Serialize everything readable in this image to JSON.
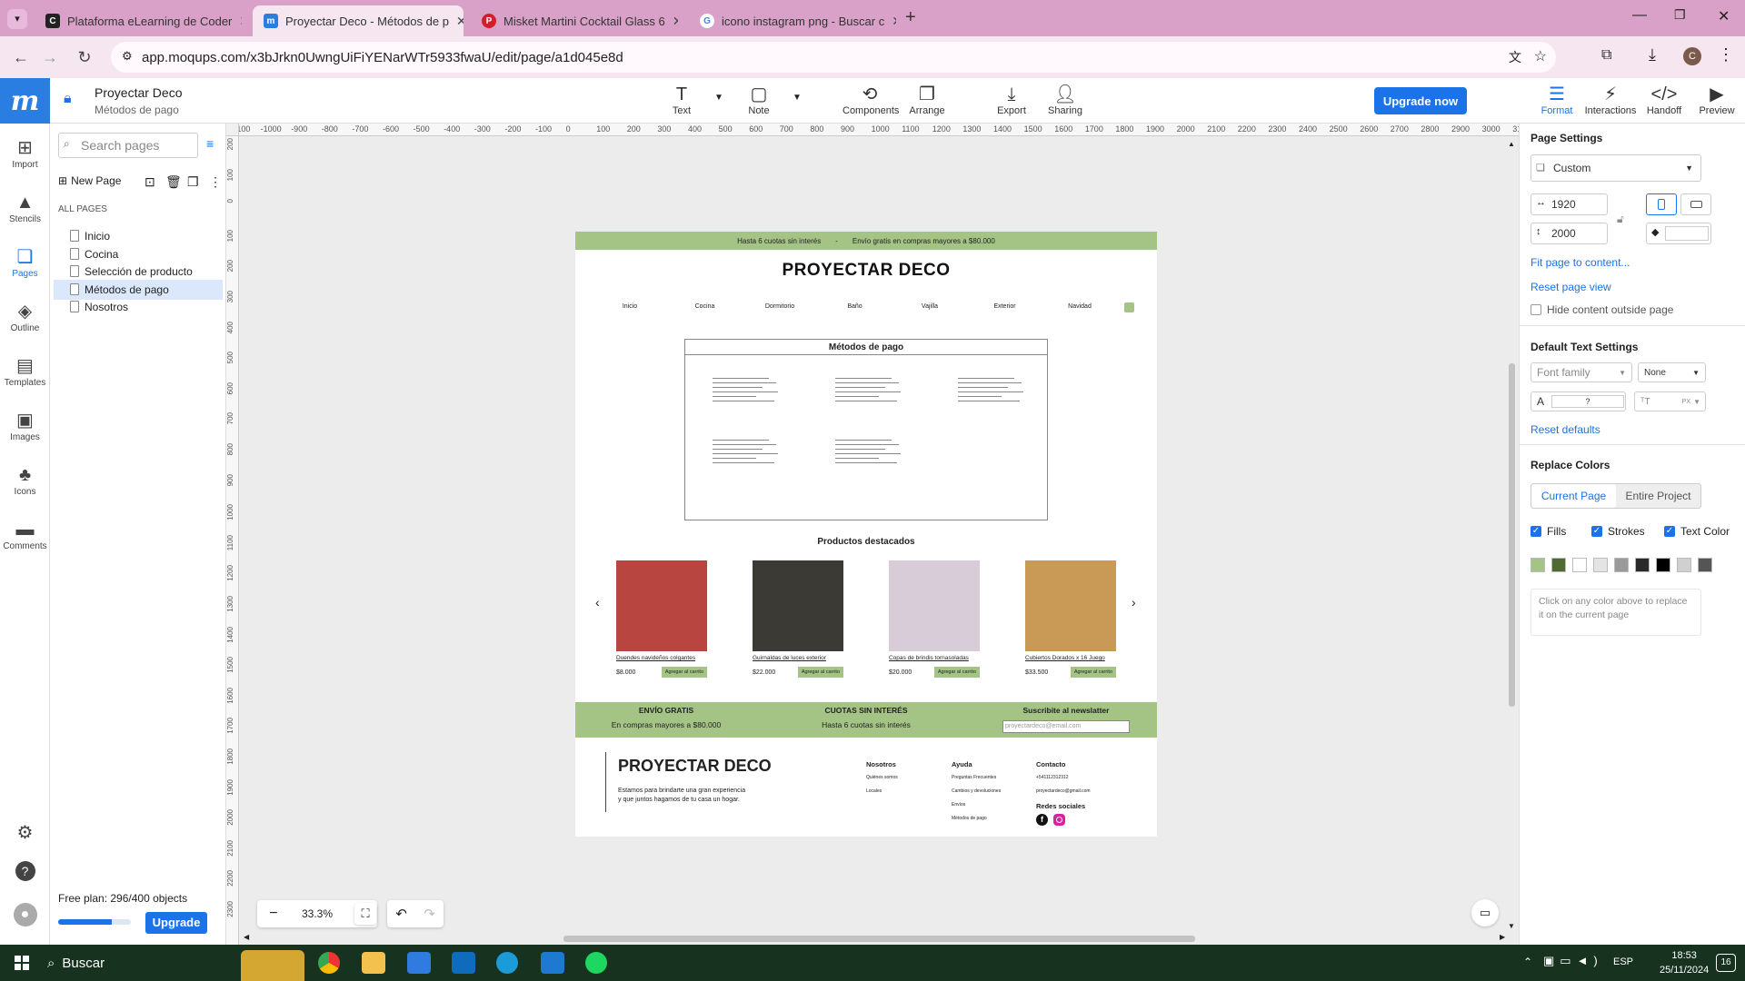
{
  "browser": {
    "tabs": [
      {
        "title": "Plataforma eLearning de Coder",
        "active": false
      },
      {
        "title": "Proyectar Deco - Métodos de p",
        "active": true
      },
      {
        "title": "Misket Martini Cocktail Glass 6",
        "active": false
      },
      {
        "title": "icono instagram png - Buscar c",
        "active": false
      }
    ],
    "url": "app.moqups.com/x3bJrkn0UwngUiFiYENarWTr5933fwaU/edit/page/a1d045e8d",
    "profile_initial": "C"
  },
  "app": {
    "project_name": "Proyectar Deco",
    "page_name": "Métodos de pago",
    "toolbar": {
      "text": "Text",
      "note": "Note",
      "components": "Components",
      "arrange": "Arrange",
      "export": "Export",
      "sharing": "Sharing",
      "upgrade_now": "Upgrade now",
      "format": "Format",
      "interactions": "Interactions",
      "handoff": "Handoff",
      "preview": "Preview"
    },
    "rail": {
      "import": "Import",
      "stencils": "Stencils",
      "pages": "Pages",
      "outline": "Outline",
      "templates": "Templates",
      "images": "Images",
      "icons": "Icons",
      "comments": "Comments"
    },
    "pages_panel": {
      "search_placeholder": "Search pages",
      "new_page": "New Page",
      "all_pages": "ALL PAGES",
      "pages": [
        "Inicio",
        "Cocina",
        "Selección de producto",
        "Métodos de pago",
        "Nosotros"
      ],
      "selected_index": 3,
      "plan_text": "Free plan: 296/400 objects",
      "plan_fraction": 0.74,
      "upgrade": "Upgrade"
    },
    "ruler_top": [
      "-1100",
      "-1000",
      "-900",
      "-800",
      "-700",
      "-600",
      "-500",
      "-400",
      "-300",
      "-200",
      "-100",
      "0",
      "100",
      "200",
      "300",
      "400",
      "500",
      "600",
      "700",
      "800",
      "900",
      "1000",
      "1100",
      "1200",
      "1300",
      "1400",
      "1500",
      "1600",
      "1700",
      "1800",
      "1900",
      "2000",
      "2100",
      "2200",
      "2300",
      "2400",
      "2500",
      "2600",
      "2700",
      "2800",
      "2900",
      "3000",
      "310"
    ],
    "ruler_left": [
      "200",
      "100",
      "0",
      "100",
      "200",
      "300",
      "400",
      "500",
      "600",
      "700",
      "800",
      "900",
      "1000",
      "1100",
      "1200",
      "1300",
      "1400",
      "1500",
      "1600",
      "1700",
      "1800",
      "1900",
      "2000",
      "2100",
      "2200",
      "2300"
    ],
    "zoom": "33.3%",
    "right_panel": {
      "page_settings": "Page Settings",
      "preset": "Custom",
      "width": "1920",
      "height": "2000",
      "fit": "Fit page to content...",
      "reset_view": "Reset page view",
      "hide_outside": "Hide content outside page",
      "default_text": "Default Text Settings",
      "font_family": "Font family",
      "font_style": "None",
      "color_q": "?",
      "size_unit": "PX",
      "reset_defaults": "Reset defaults",
      "replace_colors": "Replace Colors",
      "current_page": "Current Page",
      "entire_project": "Entire Project",
      "fills": "Fills",
      "strokes": "Strokes",
      "text_color": "Text Color",
      "swatches": [
        "#a4c485",
        "#4f6b33",
        "#ffffff",
        "#e4e4e4",
        "#9a9a9a",
        "#2a2a2a",
        "#000000",
        "#d0d0d0",
        "#555555"
      ],
      "hint": "Click on any color above to replace it on the current page"
    }
  },
  "mockup": {
    "promo": [
      "Hasta 6 cuotas sin interés",
      "-",
      "Envío gratis en compras mayores a $80.000"
    ],
    "brand": "PROYECTAR DECO",
    "nav": [
      "Inicio",
      "Cocina",
      "Dormitorio",
      "Baño",
      "Vajilla",
      "Exterior",
      "Navidad"
    ],
    "methods_title": "Métodos de pago",
    "featured_title": "Productos destacados",
    "prev": "‹",
    "next": "›",
    "products": [
      {
        "name": "Duendes navideños colgantes",
        "price": "$8.000",
        "button": "Agregar al carrito",
        "color": "#b8453f"
      },
      {
        "name": "Guirnaldas de luces exterior",
        "price": "$22.000",
        "button": "Agregar al carrito",
        "color": "#3b3a35"
      },
      {
        "name": "Copas de brindis tornasoladas",
        "price": "$20.000",
        "button": "Agregar al carrito",
        "color": "#d8ccd8"
      },
      {
        "name": "Cubiertos Dorados x 16 Juego",
        "price": "$33.500",
        "button": "Agregar al carrito",
        "color": "#c89a55"
      }
    ],
    "band": {
      "envio_title": "ENVÍO GRATIS",
      "envio_text": "En compras mayores a $80.000",
      "cuotas_title": "CUOTAS SIN INTERÉS",
      "cuotas_text": "Hasta 6 cuotas sin interés",
      "news_title": "Suscribite al newslatter",
      "news_placeholder": "proyectardeco@email.com"
    },
    "footer": {
      "brand": "PROYECTAR DECO",
      "tagline1": "Estamos para brindarte una gran experiencia",
      "tagline2": "y que juntos hagamos de tu casa un hogar.",
      "nosotros": "Nosotros",
      "quienes": "Quiénes somos",
      "locales": "Locales",
      "ayuda": "Ayuda",
      "faq": "Preguntas Frecuentes",
      "cambios": "Cambios y devoluciones",
      "envios": "Envíos",
      "metodos": "Métodos de pago",
      "contacto": "Contacto",
      "phone": "+541112312312",
      "email": "proyectardeco@gmail.com",
      "redes": "Redes sociales"
    }
  },
  "taskbar": {
    "search": "Buscar",
    "lang": "ESP",
    "time": "18:53",
    "date": "25/11/2024",
    "notif": "16"
  }
}
